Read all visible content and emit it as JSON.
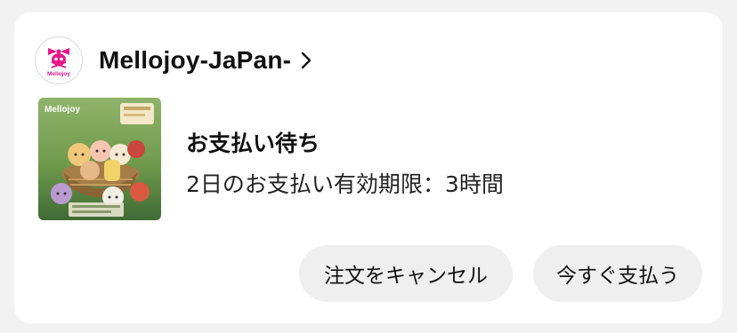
{
  "store": {
    "name": "Mellojoy-JaPan-",
    "logo_text": "Mellojoy",
    "logo_icon": "skull-bow-logo-icon"
  },
  "order": {
    "status": "お支払い待ち",
    "deadline": "2日のお支払い有効期限：3時間",
    "thumbnail_brand": "Mellojoy"
  },
  "actions": {
    "cancel_label": "注文をキャンセル",
    "pay_label": "今すぐ支払う"
  },
  "colors": {
    "brand_pink": "#e8178a",
    "card_bg": "#ffffff",
    "page_bg": "#f2f2f2",
    "button_bg": "#efefef"
  }
}
